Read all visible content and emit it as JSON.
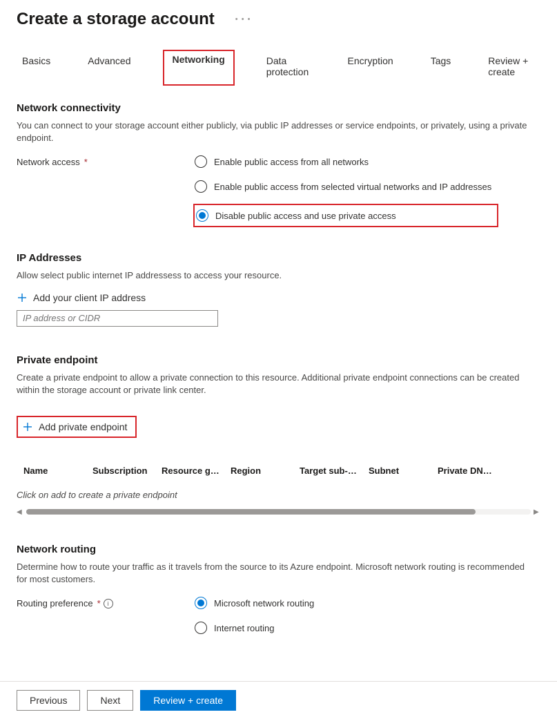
{
  "header": {
    "title": "Create a storage account"
  },
  "tabs": [
    {
      "label": "Basics",
      "active": false
    },
    {
      "label": "Advanced",
      "active": false
    },
    {
      "label": "Networking",
      "active": true
    },
    {
      "label": "Data protection",
      "active": false
    },
    {
      "label": "Encryption",
      "active": false
    },
    {
      "label": "Tags",
      "active": false
    },
    {
      "label": "Review + create",
      "active": false
    }
  ],
  "network_connectivity": {
    "title": "Network connectivity",
    "description": "You can connect to your storage account either publicly, via public IP addresses or service endpoints, or privately, using a private endpoint.",
    "field_label": "Network access",
    "options": [
      {
        "label": "Enable public access from all networks",
        "selected": false
      },
      {
        "label": "Enable public access from selected virtual networks and IP addresses",
        "selected": false
      },
      {
        "label": "Disable public access and use private access",
        "selected": true
      }
    ]
  },
  "ip_addresses": {
    "title": "IP Addresses",
    "description": "Allow select public internet IP addressess to access your resource.",
    "add_label": "Add your client IP address",
    "placeholder": "IP address or CIDR"
  },
  "private_endpoint": {
    "title": "Private endpoint",
    "description": "Create a private endpoint to allow a private connection to this resource. Additional private endpoint connections can be created within the storage account or private link center.",
    "add_label": "Add private endpoint",
    "columns": {
      "name": "Name",
      "subscription": "Subscription",
      "resource_group": "Resource g…",
      "region": "Region",
      "target_sub": "Target sub-…",
      "subnet": "Subnet",
      "private_dns": "Private DN…"
    },
    "empty_text": "Click on add to create a private endpoint"
  },
  "network_routing": {
    "title": "Network routing",
    "description": "Determine how to route your traffic as it travels from the source to its Azure endpoint. Microsoft network routing is recommended for most customers.",
    "field_label": "Routing preference",
    "options": [
      {
        "label": "Microsoft network routing",
        "selected": true
      },
      {
        "label": "Internet routing",
        "selected": false
      }
    ]
  },
  "footer": {
    "previous": "Previous",
    "next": "Next",
    "review": "Review + create"
  }
}
